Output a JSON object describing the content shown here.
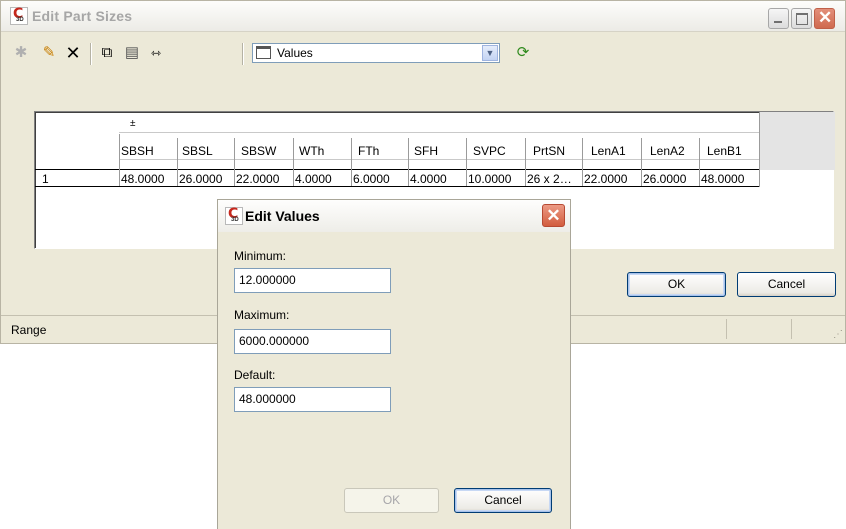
{
  "window": {
    "title": "Edit Part Sizes",
    "icon_letters": "C",
    "icon_sub": "3D"
  },
  "toolbar": {
    "new_icon": "new-row-icon",
    "edit_icon": "edit-pencil-icon",
    "delete_icon": "delete-x-icon",
    "copy_icon": "copy-icon",
    "paste_icon": "paste-icon",
    "fit_icon": "fit-width-icon",
    "combo_value": "Values",
    "refresh_icon": "refresh-icon"
  },
  "grid": {
    "group_marker": "±",
    "columns": [
      "SBSH",
      "SBSL",
      "SBSW",
      "WTh",
      "FTh",
      "SFH",
      "SVPC",
      "PrtSN",
      "LenA1",
      "LenA2",
      "LenB1"
    ],
    "row_number": "1",
    "rows": [
      [
        "48.0000",
        "26.0000",
        "22.0000",
        "4.0000",
        "6.0000",
        "4.0000",
        "10.0000",
        "26 x 2…",
        "22.0000",
        "26.0000",
        "48.0000"
      ]
    ]
  },
  "buttons": {
    "ok": "OK",
    "cancel": "Cancel"
  },
  "status": {
    "text": "Range"
  },
  "dialog": {
    "title": "Edit Values",
    "min_label": "Minimum:",
    "min_value": "12.000000",
    "max_label": "Maximum:",
    "max_value": "6000.000000",
    "default_label": "Default:",
    "default_value": "48.000000",
    "ok": "OK",
    "cancel": "Cancel"
  }
}
